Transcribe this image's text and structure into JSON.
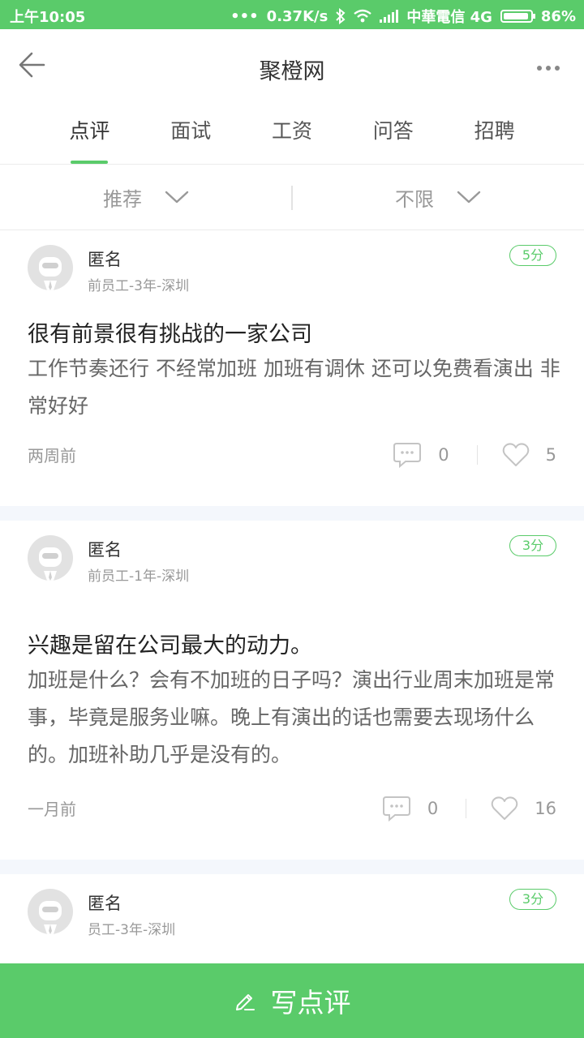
{
  "status_bar": {
    "time": "上午10:05",
    "dots": "•••",
    "speed": "0.37K/s",
    "carrier": "中華電信 4G",
    "battery": "86%"
  },
  "header": {
    "title": "聚橙网",
    "back_icon": "arrow-left-icon",
    "more_icon": "more-horizontal-icon"
  },
  "tabs": [
    {
      "label": "点评",
      "active": true
    },
    {
      "label": "面试",
      "active": false
    },
    {
      "label": "工资",
      "active": false
    },
    {
      "label": "问答",
      "active": false
    },
    {
      "label": "招聘",
      "active": false
    }
  ],
  "filters": [
    {
      "label": "推荐"
    },
    {
      "label": "不限"
    }
  ],
  "reviews": [
    {
      "author": "匿名",
      "meta": "前员工-3年-深圳",
      "score": "5分",
      "title": "很有前景很有挑战的一家公司",
      "body": "工作节奏还行 不经常加班 加班有调休 还可以免费看演出 非常好好",
      "time": "两周前",
      "comments": "0",
      "likes": "5"
    },
    {
      "author": "匿名",
      "meta": "前员工-1年-深圳",
      "score": "3分",
      "title": "兴趣是留在公司最大的动力。",
      "body": "加班是什么？会有不加班的日子吗？演出行业周末加班是常事，毕竟是服务业嘛。晚上有演出的话也需要去现场什么的。加班补助几乎是没有的。",
      "time": "一月前",
      "comments": "0",
      "likes": "16"
    },
    {
      "author": "匿名",
      "meta": "员工-3年-深圳",
      "score": "3分"
    }
  ],
  "write_button": {
    "label": "写点评",
    "icon": "pencil-icon"
  },
  "colors": {
    "accent": "#5acb6a",
    "divider_band": "#f4f7fc"
  }
}
